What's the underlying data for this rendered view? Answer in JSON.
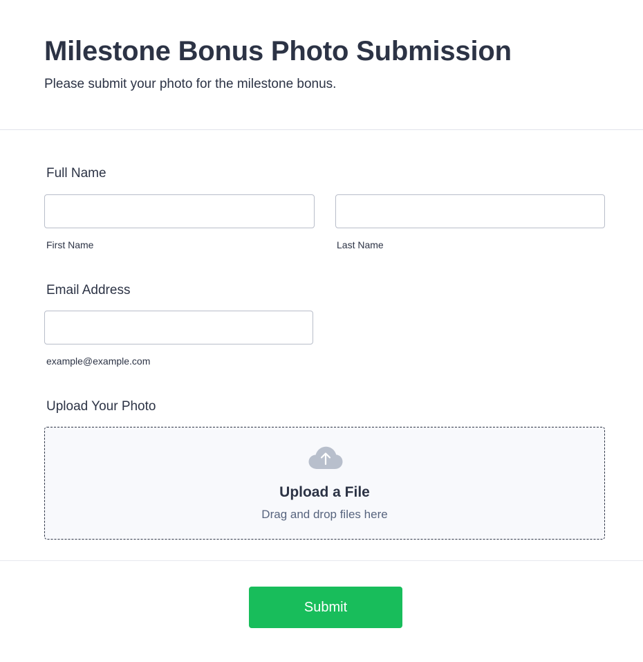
{
  "header": {
    "title": "Milestone Bonus Photo Submission",
    "subtitle": "Please submit your photo for the milestone bonus."
  },
  "form": {
    "full_name": {
      "label": "Full Name",
      "first_name": {
        "value": "",
        "sublabel": "First Name"
      },
      "last_name": {
        "value": "",
        "sublabel": "Last Name"
      }
    },
    "email": {
      "label": "Email Address",
      "value": "",
      "sublabel": "example@example.com"
    },
    "photo_upload": {
      "label": "Upload Your Photo",
      "title": "Upload a File",
      "hint": "Drag and drop files here",
      "icon": "cloud-upload-icon"
    },
    "submit_label": "Submit"
  },
  "colors": {
    "text": "#2c3345",
    "muted_text": "#57647e",
    "input_border": "#b8bdc9",
    "upload_background": "#f8f9fc",
    "upload_icon": "#b8bfcc",
    "submit_background": "#18bd5b",
    "submit_text": "#ffffff"
  }
}
